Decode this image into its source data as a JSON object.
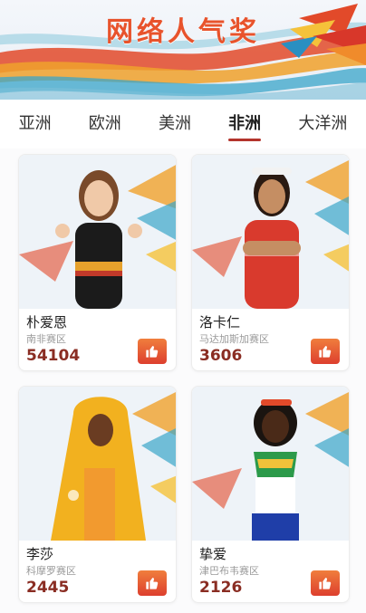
{
  "header": {
    "title": "网络人气奖"
  },
  "tabs": [
    {
      "label": "亚洲",
      "active": false
    },
    {
      "label": "欧洲",
      "active": false
    },
    {
      "label": "美洲",
      "active": false
    },
    {
      "label": "非洲",
      "active": true
    },
    {
      "label": "大洋洲",
      "active": false
    }
  ],
  "cards": [
    {
      "name": "朴爱恩",
      "region": "南非赛区",
      "votes": "54104",
      "like_icon": "thumbs-up-icon"
    },
    {
      "name": "洛卡仁",
      "region": "马达加斯加赛区",
      "votes": "3606",
      "like_icon": "thumbs-up-icon"
    },
    {
      "name": "李莎",
      "region": "科摩罗赛区",
      "votes": "2445",
      "like_icon": "thumbs-up-icon"
    },
    {
      "name": "挚爱",
      "region": "津巴布韦赛区",
      "votes": "2126",
      "like_icon": "thumbs-up-icon"
    }
  ],
  "colors": {
    "accent": "#e8532c",
    "tab_underline": "#b3342c",
    "votes": "#8a2d23",
    "like_button": "#e2552f"
  }
}
